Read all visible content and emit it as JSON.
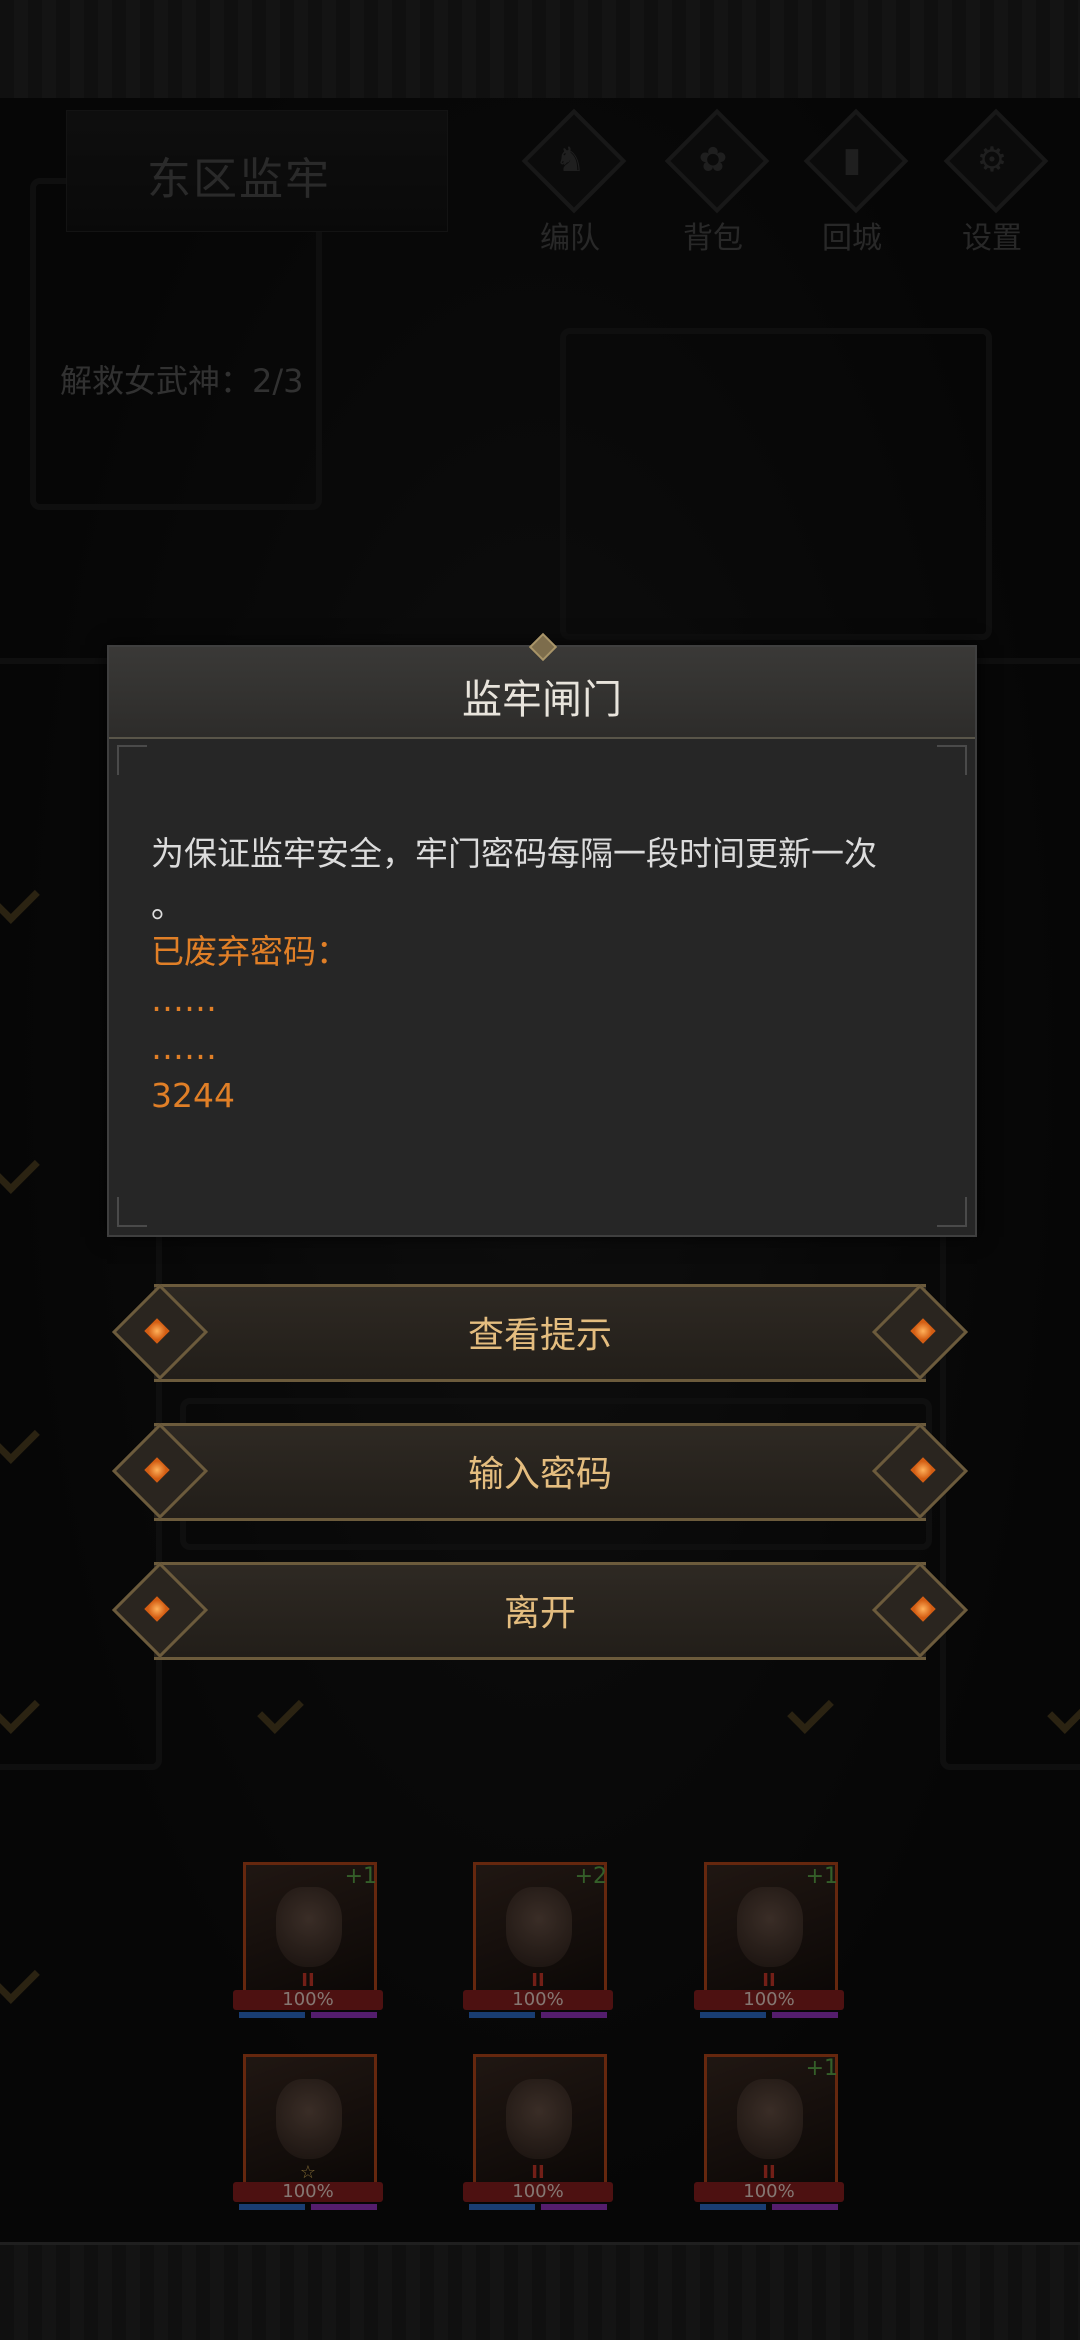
{
  "header": {
    "area_title": "东区监牢",
    "buttons": [
      {
        "icon": "helmet-icon",
        "glyph": "♞",
        "label": "编队"
      },
      {
        "icon": "bag-icon",
        "glyph": "✿",
        "label": "背包"
      },
      {
        "icon": "door-icon",
        "glyph": "▮",
        "label": "回城"
      },
      {
        "icon": "gear-icon",
        "glyph": "⚙",
        "label": "设置"
      }
    ]
  },
  "progress": {
    "label": "解救女武神：2/3",
    "rescued": 2,
    "total": 3
  },
  "dialog": {
    "title": "监牢闸门",
    "message": "为保证监牢安全，牢门密码每隔一段时间更新一次",
    "message_tail": "。",
    "discarded_label": "已废弃密码：",
    "lines": [
      "……",
      "……",
      "3244"
    ]
  },
  "actions": [
    "查看提示",
    "输入密码",
    "离开"
  ],
  "heroes": [
    {
      "plus": "+1",
      "rank": "II",
      "hp": "100%"
    },
    {
      "plus": "+2",
      "rank": "II",
      "hp": "100%"
    },
    {
      "plus": "+1",
      "rank": "II",
      "hp": "100%"
    },
    {
      "plus": "",
      "rank": "☆",
      "hp": "100%"
    },
    {
      "plus": "",
      "rank": "II",
      "hp": "100%"
    },
    {
      "plus": "+1",
      "rank": "II",
      "hp": "100%"
    }
  ],
  "colors": {
    "accent_orange": "#e07f27",
    "button_text": "#e4bd7f",
    "hp_red": "#8c1f1f"
  }
}
